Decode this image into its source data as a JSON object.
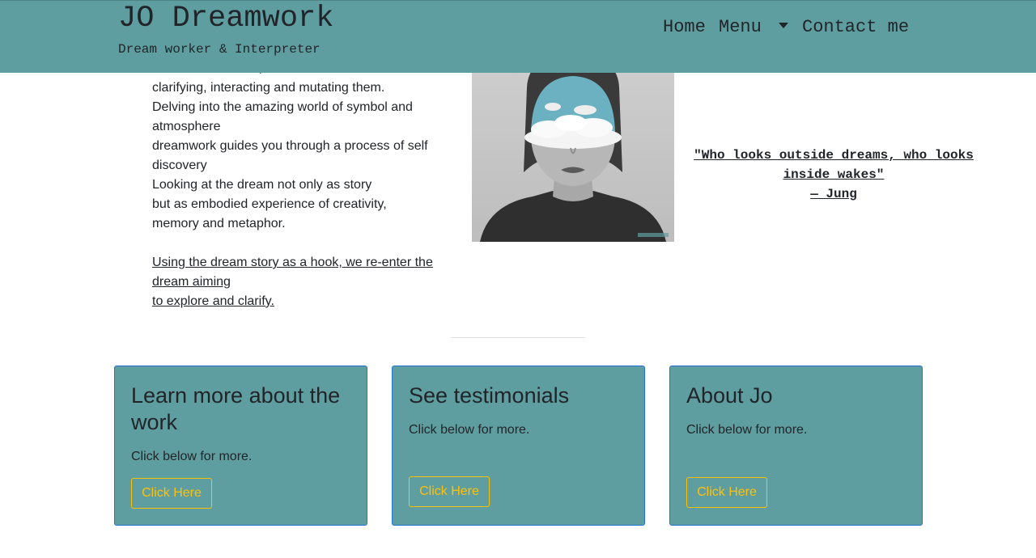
{
  "header": {
    "title": "JO Dreamwork",
    "subtitle": "Dream worker & Interpreter",
    "nav": {
      "home": "Home",
      "menu": "Menu",
      "contact": "Contact me"
    }
  },
  "intro": {
    "lines": [
      "rediscover dreams,",
      "clarifying, interacting and mutating them.",
      "Delving into the amazing world of symbol and",
      "atmosphere",
      "dreamwork guides you through a process of self",
      "discovery",
      "Looking at the dream not only as story",
      "but as embodied experience of creativity,",
      "memory and metaphor."
    ],
    "link_lines": [
      "Using the dream story as a hook, we re-enter the",
      "dream aiming",
      "to explore and clarify."
    ]
  },
  "quote": {
    "text_line1": "\"Who looks outside dreams, who looks",
    "text_line2": "inside wakes\"",
    "author": "— Jung"
  },
  "cards": [
    {
      "title": "Learn more about the work",
      "text": "Click below for more.",
      "button": "Click Here"
    },
    {
      "title": "See testimonials",
      "text": "Click below for more.",
      "button": "Click Here"
    },
    {
      "title": "About Jo",
      "text": "Click below for more.",
      "button": "Click Here"
    }
  ],
  "colors": {
    "header_bg": "#5f9ea0",
    "card_bg": "#5f9ea0",
    "card_border": "#1f74d8",
    "button_accent": "#ffc107"
  }
}
